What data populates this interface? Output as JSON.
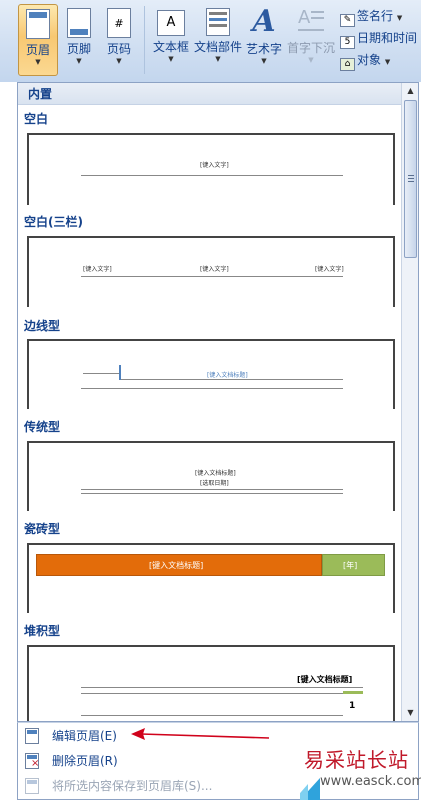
{
  "ribbon": {
    "buttons": [
      {
        "label": "页眉",
        "icon": "header-icon",
        "active": true
      },
      {
        "label": "页脚",
        "icon": "footer-icon"
      },
      {
        "label": "页码",
        "icon": "page-number-icon"
      },
      {
        "label": "文本框",
        "icon": "textbox-icon"
      },
      {
        "label": "文档部件",
        "icon": "quick-parts-icon"
      },
      {
        "label": "艺术字",
        "icon": "wordart-icon"
      },
      {
        "label": "首字下沉",
        "icon": "drop-cap-icon",
        "disabled": true
      }
    ],
    "small": [
      {
        "label": "签名行",
        "icon": "signature-line-icon",
        "has_dropdown": true
      },
      {
        "label": "日期和时间",
        "icon": "date-time-icon"
      },
      {
        "label": "对象",
        "icon": "object-icon",
        "has_dropdown": true
      }
    ]
  },
  "gallery": {
    "header": "内置",
    "sections": [
      {
        "title": "空白",
        "texts": [
          "[键入文字]"
        ]
      },
      {
        "title": "空白(三栏)",
        "texts": [
          "[键入文字]",
          "[键入文字]",
          "[键入文字]"
        ]
      },
      {
        "title": "边线型",
        "texts": [
          "[键入文档标题]"
        ]
      },
      {
        "title": "传统型",
        "texts": [
          "[键入文档标题]",
          "[选取日期]"
        ]
      },
      {
        "title": "瓷砖型",
        "texts": [
          "[键入文档标题]",
          "[年]"
        ]
      },
      {
        "title": "堆积型",
        "texts": [
          "[键入文档标题]",
          "1"
        ]
      }
    ]
  },
  "menu": {
    "items": [
      {
        "label": "编辑页眉(E)",
        "icon": "edit-header-icon"
      },
      {
        "label": "删除页眉(R)",
        "icon": "remove-header-icon"
      },
      {
        "label": "将所选内容保存到页眉库(S)...",
        "icon": "save-to-gallery-icon",
        "disabled": true
      }
    ]
  },
  "watermark": {
    "title": "易采站长站",
    "url": "www.easck.com"
  },
  "colors": {
    "accent_orange": "#e36c0a",
    "accent_green": "#9bbb59",
    "annotation_arrow": "#d0021b",
    "ribbon_blue": "#15428b"
  }
}
